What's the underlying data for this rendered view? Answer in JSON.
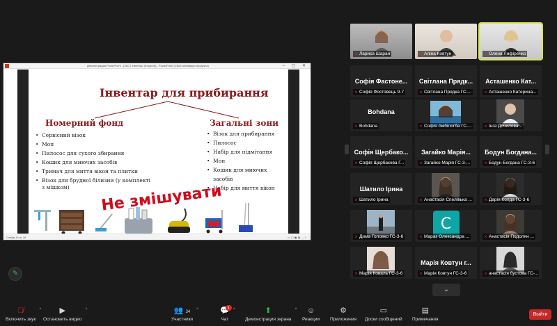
{
  "share": {
    "window_title": "Демонстрация PowerPoint - [ЗАСТ інвентар (Eduprof)] - PowerPoint (Сбой активации продукта)",
    "status_left": "Слайд 10 из 16",
    "status_right": "▭  ▢  ▣  ▤  — +"
  },
  "slide": {
    "title": "Інвентар для прибирання",
    "left_heading": "Номерний  фонд",
    "right_heading": "Загальні зони",
    "left_items": [
      "Сервісний візок",
      "Моп",
      "Пилосос для сухого збирання",
      "Кошик для миючих засобів",
      "Тримач для миття вікон та плитки",
      "Візок для брудної білизни (у комплекті з мішком)"
    ],
    "right_items": [
      "Візок для прибирання",
      "Пилосос",
      "Набір для підмітання",
      "Моп",
      "Кошик для миючих засобів",
      "Набір для миття вікон"
    ],
    "warning": "Не змішувати",
    "accent_color": "#8b1a1a",
    "warning_color": "#d10a1c"
  },
  "gallery": {
    "top": [
      {
        "label": "Лариса Шаран"
      },
      {
        "label": "Аліна Ковтун"
      },
      {
        "label": "Олена Лифіренко"
      }
    ],
    "rows": [
      [
        {
          "name": "Софія  Фастоне...",
          "label": "Софія Фостовець 9-7"
        },
        {
          "name": "Світлана  Прядк...",
          "label": "Світлана Прядка ГС-..."
        },
        {
          "name": "Асташенко  Кат...",
          "label": "Асташенко Катерина..."
        }
      ],
      [
        {
          "name": "Bohdana",
          "label": "Bohdana"
        },
        {
          "name": "",
          "label": "Софія Амбілогба ГС-..."
        },
        {
          "name": "",
          "label": "Інга Дочилова..."
        }
      ],
      [
        {
          "name": "Софія  Щербако...",
          "label": "Софія Щербакова Г..."
        },
        {
          "name": "Загайко  Марія...",
          "label": "Загайко Марія ГС-3-..."
        },
        {
          "name": "Бодун  Богдана...",
          "label": "Бодун Богдана ГС-3-6"
        }
      ],
      [
        {
          "name": "Шатило  Ірина",
          "label": "Шатило Ірина"
        },
        {
          "name": "",
          "label": "Анастасія Спелівька ..."
        },
        {
          "name": "",
          "label": "Дарія Колда ГС-3-6"
        }
      ],
      [
        {
          "name": "",
          "label": "Дима Головко ГС-3-6"
        },
        {
          "name": "C",
          "label": "Мараз Олександра ..."
        },
        {
          "name": "",
          "label": "Анастасія Подолян ..."
        }
      ],
      [
        {
          "name": "",
          "label": "Марія Коваль ГС-3-6"
        },
        {
          "name": "Марія  Ковтун  г...",
          "label": "Марія Ковтун ГС-3-6"
        },
        {
          "name": "",
          "label": "анастасія бустова ГС-..."
        }
      ]
    ],
    "avatar_color": "#10a5a5",
    "down_arrow": "⌄"
  },
  "toolbar": {
    "mute": "Включить звук",
    "video": "Остановить видео",
    "participants": "Участники",
    "participants_count": "34",
    "chat": "Чат",
    "chat_badge": "1",
    "share": "Демонстрация экрана",
    "reactions": "Реакции",
    "apps": "Приложения",
    "whiteboards": "Доски сообщений",
    "notes": "Примечания",
    "leave": "Выйти"
  },
  "icons": {
    "mic": "mic-off-icon",
    "pencil": "pencil-icon"
  }
}
